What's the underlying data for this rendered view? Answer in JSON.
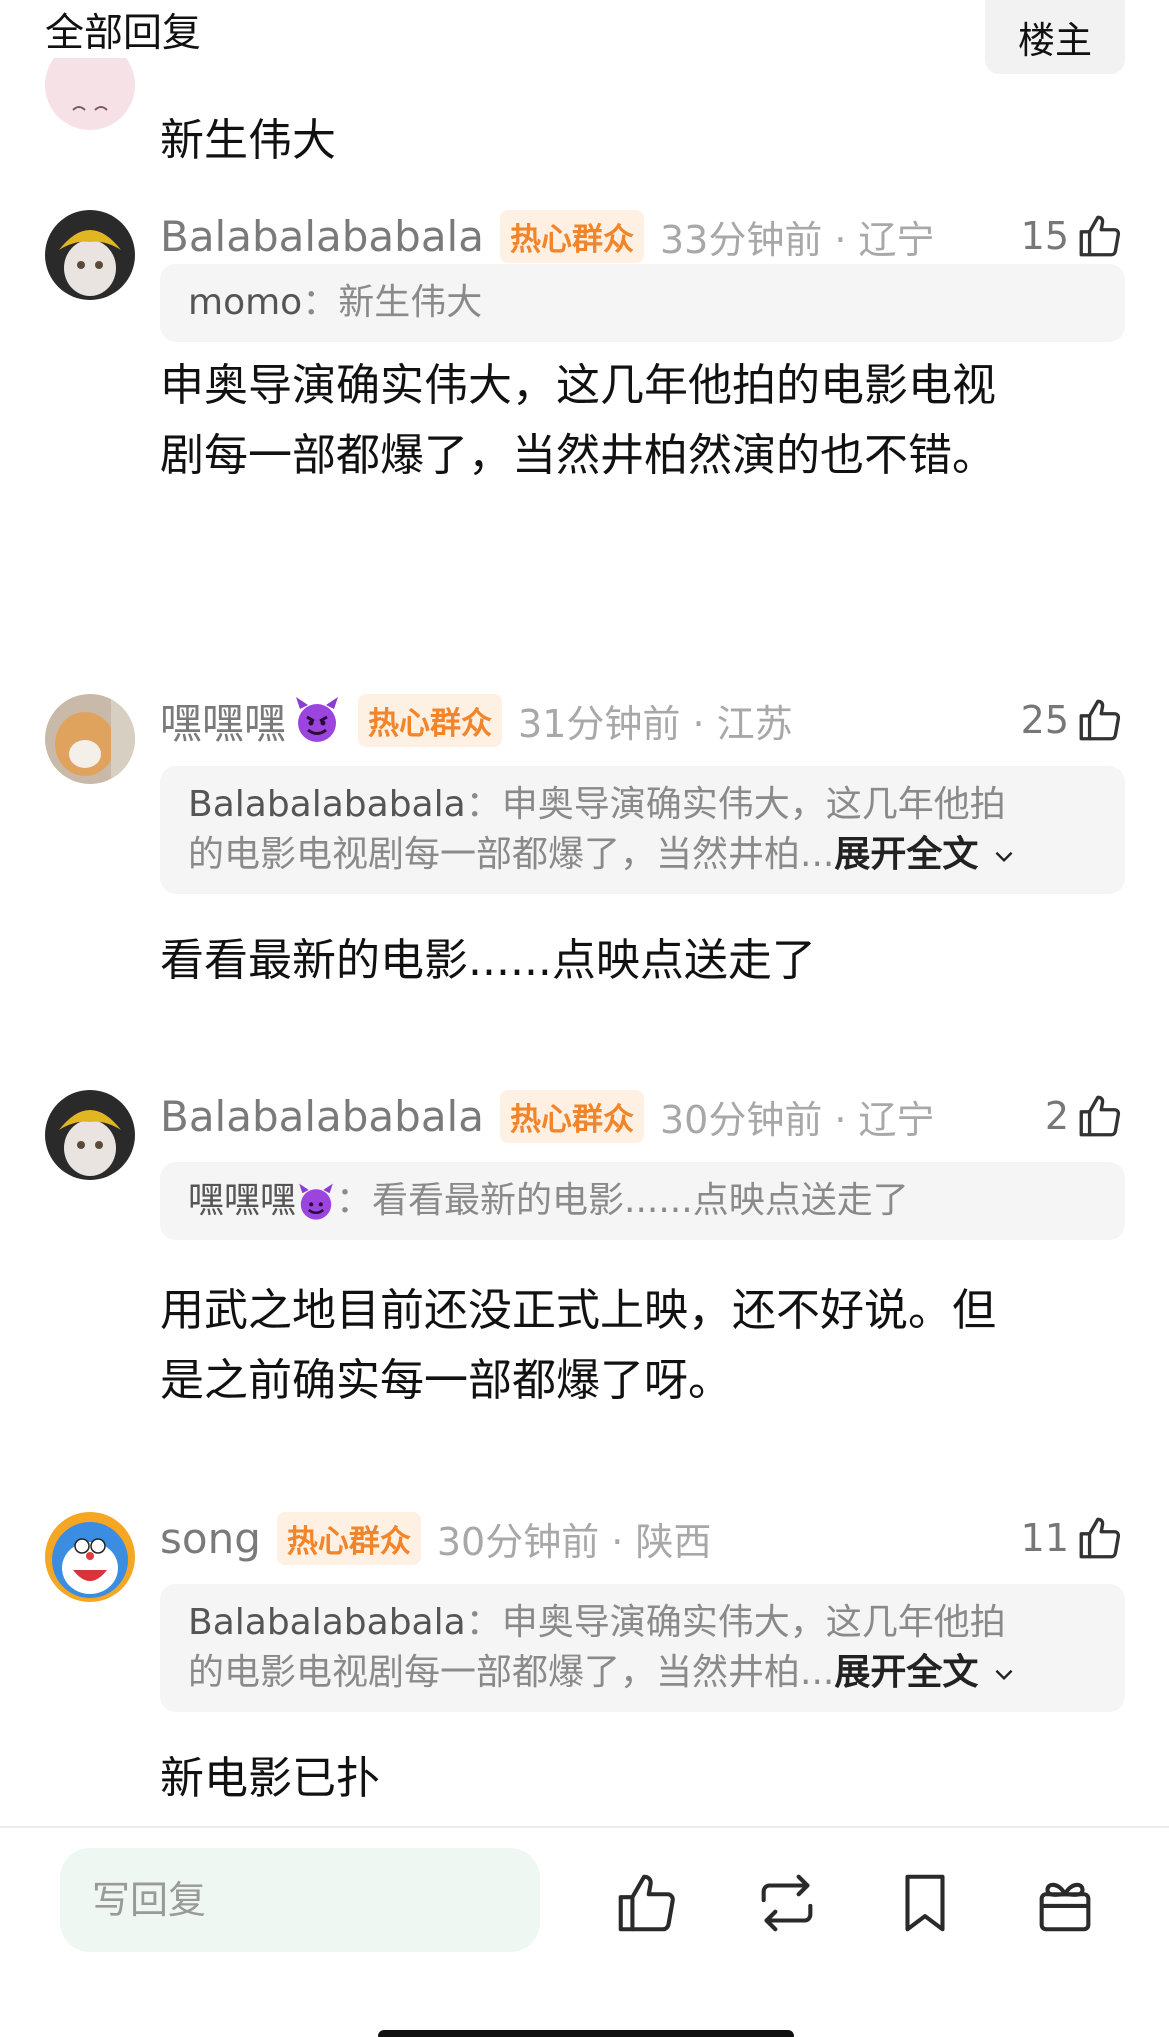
{
  "header": {
    "title": "全部回复",
    "op_filter": "楼主"
  },
  "partial_comment": {
    "body": "新生伟大"
  },
  "comments": [
    {
      "username": "Balabalababala",
      "badge": "热心群众",
      "time": "33分钟前 · 辽宁",
      "likes": "15",
      "quote_user": "momo",
      "quote_text": "新生伟大",
      "body_lines": [
        "申奥导演确实伟大，这几年他拍的电影电视",
        "剧每一部都爆了，当然井柏然演的也不错。"
      ]
    },
    {
      "username": "嘿嘿嘿",
      "badge": "热心群众",
      "time": "31分钟前 · 江苏",
      "likes": "25",
      "quote_user": "Balabalababala",
      "quote_line1": "申奥导演确实伟大，这几年他拍",
      "quote_line2": "的电影电视剧每一部都爆了，当然井柏...",
      "expand": "展开全文",
      "body": "看看最新的电影......点映点送走了"
    },
    {
      "username": "Balabalababala",
      "badge": "热心群众",
      "time": "30分钟前 · 辽宁",
      "likes": "2",
      "quote_user": "嘿嘿嘿",
      "quote_text": "看看最新的电影......点映点送走了",
      "body_lines": [
        "用武之地目前还没正式上映，还不好说。但",
        "是之前确实每一部都爆了呀。"
      ]
    },
    {
      "username": "song",
      "badge": "热心群众",
      "time": "30分钟前 · 陕西",
      "likes": "11",
      "quote_user": "Balabalababala",
      "quote_line1": "申奥导演确实伟大，这几年他拍",
      "quote_line2": "的电影电视剧每一部都爆了，当然井柏...",
      "expand": "展开全文",
      "body": "新电影已扑"
    }
  ],
  "bottom_bar": {
    "reply_placeholder": "写回复",
    "icons": [
      "like-icon",
      "repost-icon",
      "bookmark-icon",
      "gift-icon"
    ]
  },
  "colors": {
    "badge_bg": "#fff0e4",
    "badge_text": "#f2852a",
    "quote_bg": "#f5f5f5",
    "reply_bg": "#eef7f1"
  }
}
